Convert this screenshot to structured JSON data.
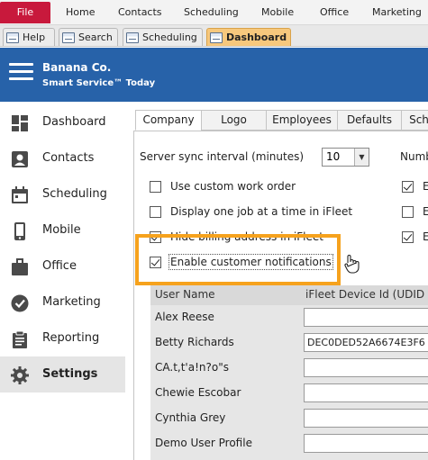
{
  "ribbon": {
    "file": "File",
    "items": [
      "Home",
      "Contacts",
      "Scheduling",
      "Mobile",
      "Office",
      "Marketing"
    ]
  },
  "doc_tabs": [
    "Help",
    "Search",
    "Scheduling",
    "Dashboard"
  ],
  "header": {
    "company": "Banana Co.",
    "product": "Smart Service™ Today"
  },
  "sidebar": {
    "items": [
      {
        "label": "Dashboard",
        "icon": "dashboard-icon"
      },
      {
        "label": "Contacts",
        "icon": "contact-card-icon"
      },
      {
        "label": "Scheduling",
        "icon": "calendar-icon"
      },
      {
        "label": "Mobile",
        "icon": "mobile-phone-icon"
      },
      {
        "label": "Office",
        "icon": "briefcase-icon"
      },
      {
        "label": "Marketing",
        "icon": "check-circle-icon"
      },
      {
        "label": "Reporting",
        "icon": "clipboard-icon"
      },
      {
        "label": "Settings",
        "icon": "gear-icon"
      }
    ],
    "active": "Settings"
  },
  "settings_tabs": [
    "Company",
    "Logo",
    "Employees",
    "Defaults",
    "Sch"
  ],
  "settings": {
    "sync_label": "Server sync interval (minutes)",
    "sync_value": "10",
    "num_label": "Numb",
    "checkboxes": [
      {
        "label": "Use custom work order",
        "checked": false
      },
      {
        "label": "Display one job at a time in iFleet",
        "checked": false
      },
      {
        "label": "Hide billing address in iFleet",
        "checked": true
      },
      {
        "label": "Enable customer notifications",
        "checked": true
      }
    ],
    "right_checks": [
      {
        "label": "E",
        "checked": true
      },
      {
        "label": "E",
        "checked": false
      },
      {
        "label": "E",
        "checked": true
      }
    ]
  },
  "users_table": {
    "headers": [
      "User Name",
      "iFleet Device Id (UDID"
    ],
    "rows": [
      {
        "name": "Alex Reese",
        "udid": ""
      },
      {
        "name": "Betty Richards",
        "udid": "DEC0DED52A6674E3F6"
      },
      {
        "name": "CA.t,t'a!n?o\"s",
        "udid": ""
      },
      {
        "name": "Chewie Escobar",
        "udid": ""
      },
      {
        "name": "Cynthia Grey",
        "udid": ""
      },
      {
        "name": "Demo User Profile",
        "udid": ""
      }
    ]
  },
  "colors": {
    "file_tab": "#c8193c",
    "header_blue": "#2762a9",
    "active_doc_tab": "#f7c87d",
    "highlight": "#f6a21d",
    "sidebar_active": "#e5e5e5"
  }
}
